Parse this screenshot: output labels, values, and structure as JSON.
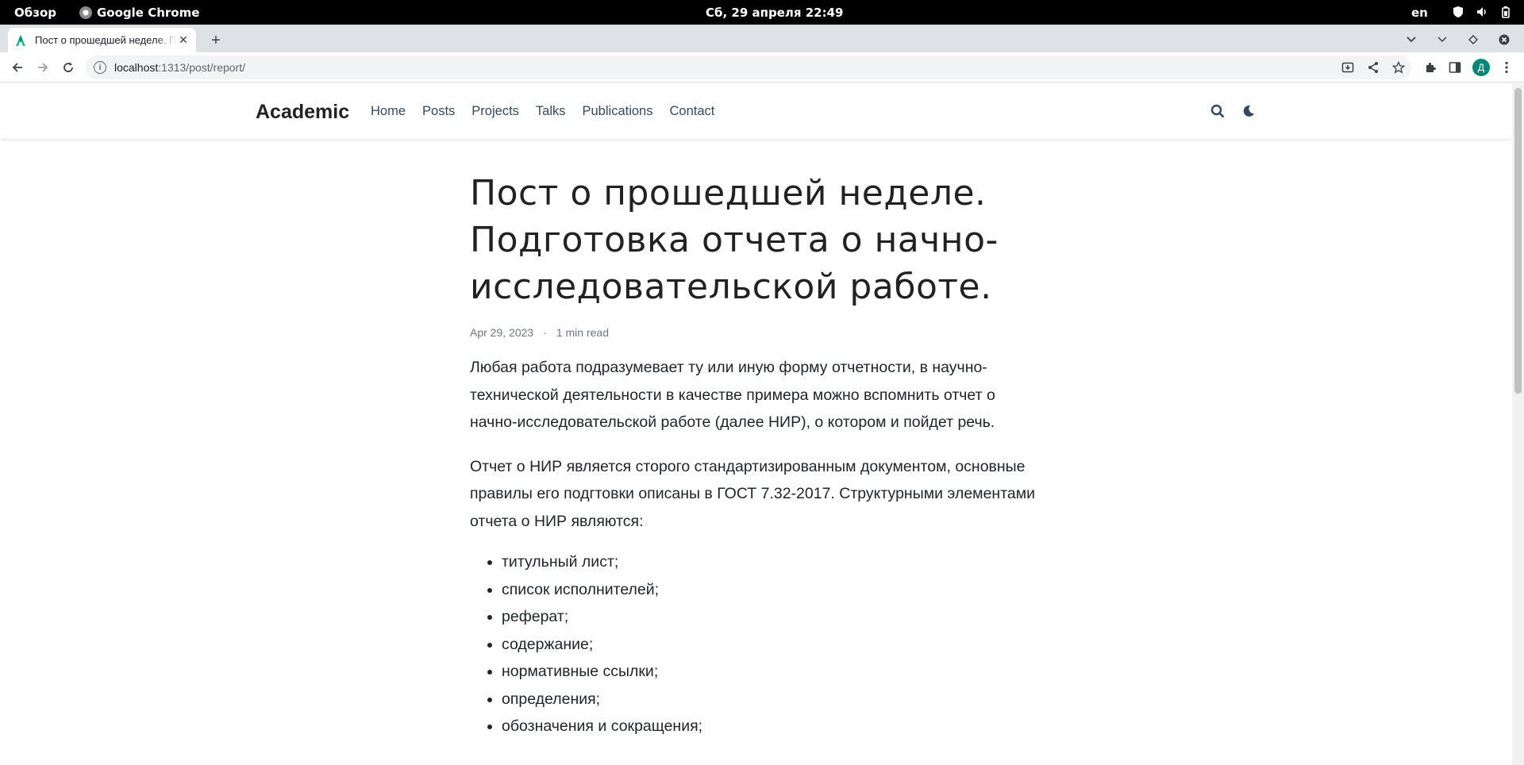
{
  "system_bar": {
    "overview": "Обзор",
    "app_name": "Google Chrome",
    "clock": "Сб, 29 апреля  22:49",
    "lang": "en"
  },
  "browser": {
    "tab_title": "Пост о прошедшей неделе. Подготовка отчета о начно-исследовательской работе.",
    "url_host": "localhost",
    "url_path": ":1313/post/report/",
    "profile_initial": "Д"
  },
  "site": {
    "brand": "Academic",
    "nav": [
      "Home",
      "Posts",
      "Projects",
      "Talks",
      "Publications",
      "Contact"
    ]
  },
  "article": {
    "title": "Пост о прошедшей неделе. Подготовка отчета о начно-исследовательской работе.",
    "date": "Apr 29, 2023",
    "separator": "·",
    "read_time": "1 min read",
    "paragraphs": [
      "Любая работа подразумевает ту или иную форму отчетности, в научно-технической деятельности в качестве примера можно вспомнить отчет о начно-исследовательской работе (далее НИР), о котором и пойдет речь.",
      "Отчет о НИР является сторого стандартизированным документом, основные правилы его подгтовки описаны в ГОСТ 7.32-2017. Структурными элементами отчета о НИР являются:"
    ],
    "list": [
      "титульный лист;",
      "список исполнителей;",
      "реферат;",
      "содержание;",
      "нормативные ссылки;",
      "определения;",
      "обозначения и сокращения;"
    ]
  }
}
